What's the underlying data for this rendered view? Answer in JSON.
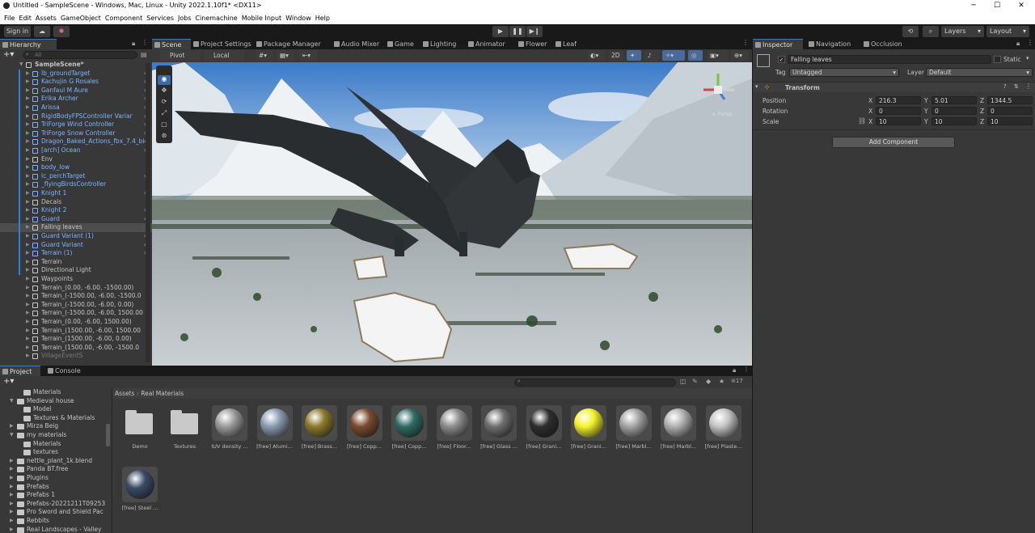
{
  "window": {
    "title": "Untitled - SampleScene - Windows, Mac, Linux - Unity 2022.1.10f1* <DX11>"
  },
  "menu": [
    "File",
    "Edit",
    "Assets",
    "GameObject",
    "Component",
    "Services",
    "Jobs",
    "Cinemachine",
    "Mobile Input",
    "Window",
    "Help"
  ],
  "toolbar": {
    "sign_in": "Sign in",
    "layers": "Layers",
    "layout": "Layout"
  },
  "hierarchy": {
    "tab": "Hierarchy",
    "search_placeholder": "All",
    "items": [
      {
        "label": "SampleScene*",
        "indent": 0,
        "type": "scene"
      },
      {
        "label": "lb_groundTarget",
        "indent": 1,
        "type": "prefab",
        "arrow": true
      },
      {
        "label": "Kachujin G Rosales",
        "indent": 1,
        "type": "prefab",
        "arrow": true
      },
      {
        "label": "Ganfaul M Aure",
        "indent": 1,
        "type": "prefab",
        "arrow": true
      },
      {
        "label": "Erika Archer",
        "indent": 1,
        "type": "prefab",
        "arrow": true
      },
      {
        "label": "Arissa",
        "indent": 1,
        "type": "prefab",
        "arrow": true
      },
      {
        "label": "RigidBodyFPSController Variar",
        "indent": 1,
        "type": "prefab",
        "arrow": true
      },
      {
        "label": "TriForge Wind Controller",
        "indent": 1,
        "type": "prefab",
        "arrow": true
      },
      {
        "label": "TriForge Snow Controller",
        "indent": 1,
        "type": "prefab",
        "arrow": true
      },
      {
        "label": "Dragon_Baked_Actions_fbx_7.4_bi",
        "indent": 1,
        "type": "prefab",
        "arrow": true
      },
      {
        "label": "[arch] Ocean",
        "indent": 1,
        "type": "prefab",
        "arrow": true
      },
      {
        "label": "Env",
        "indent": 1,
        "type": "go"
      },
      {
        "label": "body_low",
        "indent": 1,
        "type": "prefab"
      },
      {
        "label": "lc_perchTarget",
        "indent": 1,
        "type": "prefab",
        "arrow": true
      },
      {
        "label": "_flyingBirdsController",
        "indent": 1,
        "type": "prefab"
      },
      {
        "label": "Knight 1",
        "indent": 1,
        "type": "prefab",
        "arrow": true
      },
      {
        "label": "Decals",
        "indent": 1,
        "type": "go"
      },
      {
        "label": "Knight 2",
        "indent": 1,
        "type": "prefab",
        "arrow": true
      },
      {
        "label": "Guard",
        "indent": 1,
        "type": "prefab",
        "arrow": true
      },
      {
        "label": "Falling leaves",
        "indent": 1,
        "type": "go",
        "selected": true
      },
      {
        "label": "Guard Variant (1)",
        "indent": 1,
        "type": "prefab",
        "arrow": true
      },
      {
        "label": "Guard Variant",
        "indent": 1,
        "type": "prefab",
        "arrow": true
      },
      {
        "label": "Terrain (1)",
        "indent": 1,
        "type": "prefab",
        "arrow": true
      },
      {
        "label": "Terrain",
        "indent": 1,
        "type": "go"
      },
      {
        "label": "Directional Light",
        "indent": 1,
        "type": "go"
      },
      {
        "label": "Waypoints",
        "indent": 1,
        "type": "go"
      },
      {
        "label": "Terrain_(0.00, -6.00, -1500.00)",
        "indent": 1,
        "type": "go"
      },
      {
        "label": "Terrain_(-1500.00, -6.00, -1500.0",
        "indent": 1,
        "type": "go"
      },
      {
        "label": "Terrain_(-1500.00, -6.00, 0.00)",
        "indent": 1,
        "type": "go"
      },
      {
        "label": "Terrain_(-1500.00, -6.00, 1500.00",
        "indent": 1,
        "type": "go"
      },
      {
        "label": "Terrain_(0.00, -6.00, 1500.00)",
        "indent": 1,
        "type": "go"
      },
      {
        "label": "Terrain_(1500.00, -6.00, 1500.00",
        "indent": 1,
        "type": "go"
      },
      {
        "label": "Terrain_(1500.00, -6.00, 0.00)",
        "indent": 1,
        "type": "go"
      },
      {
        "label": "Terrain_(1500.00, -6.00, -1500.0",
        "indent": 1,
        "type": "go"
      },
      {
        "label": "VillageEventS",
        "indent": 1,
        "type": "go",
        "dim": true
      }
    ]
  },
  "scene_tabs": [
    "Scene",
    "Project Settings",
    "Package Manager",
    "Audio Mixer",
    "Game",
    "Lighting",
    "Animator",
    "Flower",
    "Leaf"
  ],
  "scene_toolbar": {
    "pivot": "Pivot",
    "local": "Local",
    "mode2d": "2D"
  },
  "gizmo": {
    "persp": "< Persp"
  },
  "inspector": {
    "tabs": [
      "Inspector",
      "Navigation",
      "Occlusion"
    ],
    "object_name": "Falling leaves",
    "static_label": "Static",
    "tag_label": "Tag",
    "tag_value": "Untagged",
    "layer_label": "Layer",
    "layer_value": "Default",
    "transform_title": "Transform",
    "rows": [
      {
        "label": "Position",
        "x": "216.3",
        "y": "5.01",
        "z": "1344.5"
      },
      {
        "label": "Rotation",
        "x": "0",
        "y": "0",
        "z": "0"
      },
      {
        "label": "Scale",
        "x": "10",
        "y": "10",
        "z": "10"
      }
    ],
    "axis": {
      "x": "X",
      "y": "Y",
      "z": "Z"
    },
    "add_component": "Add Component"
  },
  "project": {
    "tabs": [
      "Project",
      "Console"
    ],
    "count": "17",
    "breadcrumb": [
      "Assets",
      "Real Materials"
    ],
    "tree": [
      {
        "label": "Materials",
        "indent": 2
      },
      {
        "label": "Medieval house",
        "indent": 1,
        "open": true
      },
      {
        "label": "Model",
        "indent": 2
      },
      {
        "label": "Textures & Materials",
        "indent": 2
      },
      {
        "label": "Mirza Beig",
        "indent": 1
      },
      {
        "label": "my materials",
        "indent": 1,
        "open": true
      },
      {
        "label": "Materials",
        "indent": 2
      },
      {
        "label": "textures",
        "indent": 2
      },
      {
        "label": "nettle_plant_1k.blend",
        "indent": 1
      },
      {
        "label": "Panda BT.free",
        "indent": 1
      },
      {
        "label": "Plugins",
        "indent": 1
      },
      {
        "label": "Prefabs",
        "indent": 1
      },
      {
        "label": "Prefabs 1",
        "indent": 1
      },
      {
        "label": "Prefabs-20221211T09253",
        "indent": 1
      },
      {
        "label": "Pro Sword and Shield Pac",
        "indent": 1
      },
      {
        "label": "Rebbits",
        "indent": 1
      },
      {
        "label": "Real Landscapes - Valley",
        "indent": 1
      }
    ],
    "assets": [
      {
        "label": "Demo",
        "kind": "folder"
      },
      {
        "label": "Textures",
        "kind": "folder"
      },
      {
        "label": "IUV density ...",
        "kind": "mat",
        "color": "#9a9a9a"
      },
      {
        "label": "[free] Alumi...",
        "kind": "mat",
        "color": "#8a9bb0"
      },
      {
        "label": "[free] Brass...",
        "kind": "mat",
        "color": "#8a7a2a"
      },
      {
        "label": "[free] Copp...",
        "kind": "mat",
        "color": "#7a4a30"
      },
      {
        "label": "[free] Copp...",
        "kind": "mat",
        "color": "#2f6a62"
      },
      {
        "label": "[free] Floor...",
        "kind": "mat",
        "color": "#8c8c8c"
      },
      {
        "label": "[free] Glass ...",
        "kind": "mat",
        "color": "#6e6e6e"
      },
      {
        "label": "[free] Grani...",
        "kind": "mat",
        "color": "#2e2e2e"
      },
      {
        "label": "[free] Grani...",
        "kind": "mat",
        "color": "#f2f22a"
      },
      {
        "label": "[free] Marbl...",
        "kind": "mat",
        "color": "#a3a3a3"
      },
      {
        "label": "[free] Marbl...",
        "kind": "mat",
        "color": "#b0b0b0"
      },
      {
        "label": "[free] Plaste...",
        "kind": "mat",
        "color": "#c3c3c3"
      },
      {
        "label": "[free] Steel ...",
        "kind": "mat",
        "color": "#3a4a66"
      }
    ]
  }
}
